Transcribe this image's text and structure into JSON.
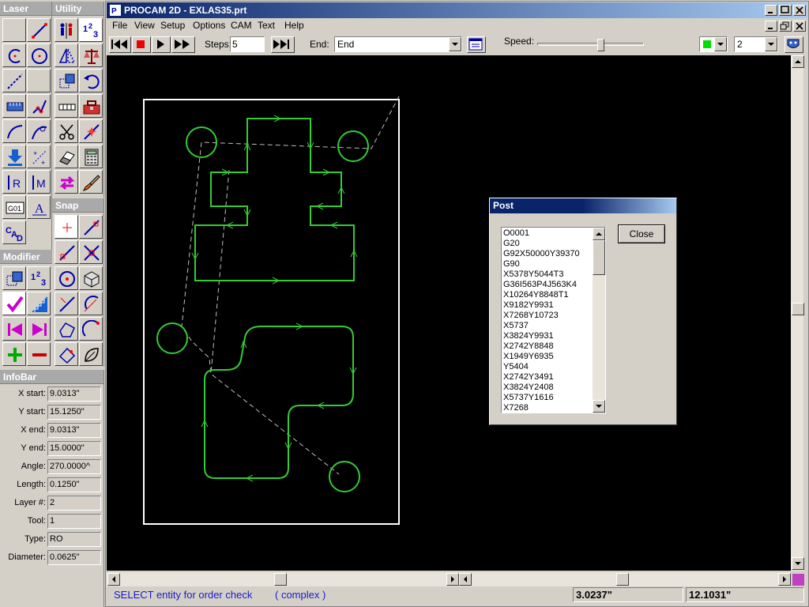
{
  "laser_panel": {
    "title": "Laser"
  },
  "utility_panel": {
    "title": "Utility"
  },
  "snap_panel": {
    "title": "Snap"
  },
  "modifier_panel": {
    "title": "Modifier"
  },
  "tool_text": {
    "irm_left": "R",
    "irm_right": "M",
    "text_tool": "A",
    "g01": "G01"
  },
  "infobar": {
    "title": "InfoBar",
    "rows": [
      {
        "label": "X start:",
        "value": "9.0313\""
      },
      {
        "label": "Y start:",
        "value": "15.1250\""
      },
      {
        "label": "X end:",
        "value": "9.0313\""
      },
      {
        "label": "Y end:",
        "value": "15.0000\""
      },
      {
        "label": "Angle:",
        "value": "270.0000^"
      },
      {
        "label": "Length:",
        "value": "0.1250\""
      },
      {
        "label": "Layer #:",
        "value": "2"
      },
      {
        "label": "Tool:",
        "value": "1"
      },
      {
        "label": "Type:",
        "value": "RO"
      },
      {
        "label": "Diameter:",
        "value": "0.0625\""
      }
    ]
  },
  "window": {
    "title": "PROCAM 2D - EXLAS35.prt"
  },
  "menu": [
    "File",
    "View",
    "Setup",
    "Options",
    "CAM",
    "Text",
    "Help"
  ],
  "toolbar": {
    "steps_label": "Steps:",
    "steps_value": "5",
    "end_label": "End:",
    "end_value": "End",
    "speed_label": "Speed:",
    "speed": 0.6,
    "layer_value": "2"
  },
  "colors": {
    "accent": "#0a246a",
    "geometry": "#33cc33",
    "path": "#c0c0c0",
    "canvas": "#000000"
  },
  "post_dialog": {
    "title": "Post",
    "close_label": "Close",
    "lines": [
      "O0001",
      "G20",
      "G92X50000Y39370",
      "G90",
      "X5378Y5044T3",
      "G36I563P4J563K4",
      "X10264Y8848T1",
      "X9182Y9931",
      "X7268Y10723",
      "X5737",
      "X3824Y9931",
      "X2742Y8848",
      "X1949Y6935",
      "Y5404",
      "X2742Y3491",
      "X3824Y2408",
      "X5737Y1616",
      "X7268"
    ]
  },
  "status": {
    "message": "SELECT entity for order check",
    "mode": "( complex )",
    "x_coord": "3.0237\"",
    "y_coord": "12.1031\""
  }
}
